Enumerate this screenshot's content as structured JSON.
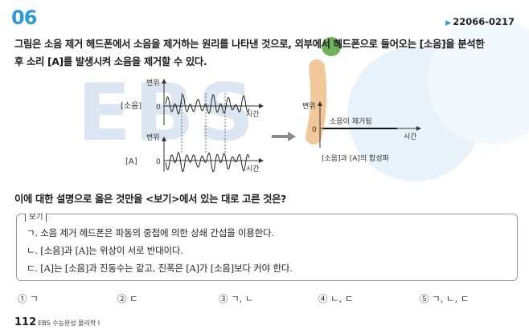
{
  "header": {
    "question_number": "06",
    "question_code": "22066-0217"
  },
  "stem": {
    "line1": "그림은 소음 제거 헤드폰에서 소음을 제거하는 원리를 나타낸 것으로, 외부에서 헤드폰으로 들어오는 [소음]을 분석한",
    "line2": "후 소리 [A]를 발생시켜 소음을 제거할 수 있다."
  },
  "figure": {
    "noise_label": "[소음]",
    "a_label": "[A]",
    "y_axis": "변위",
    "x_axis": "시간",
    "origin": "0",
    "result_annotation": "소음이 제거됨",
    "caption": "[소음]과 [A]의 합성파"
  },
  "question": "이에 대한 설명으로 옳은 것만을 <보기>에서 있는 대로 고른 것은?",
  "bogi": {
    "label": "보기",
    "items": [
      "ㄱ. 소음 제거 헤드폰은 파동의 중첩에 의한 상쇄 간섭을 이용한다.",
      "ㄴ. [소음]과 [A]는 위상이 서로 반대이다.",
      "ㄷ. [A]는 [소음]과 진동수는 같고, 진폭은 [A]가 [소음]보다 커야 한다."
    ]
  },
  "choices": [
    "① ㄱ",
    "② ㄷ",
    "③ ㄱ, ㄴ",
    "④ ㄴ, ㄷ",
    "⑤ ㄱ, ㄴ, ㄷ"
  ],
  "footer": {
    "page_number": "112",
    "book_title": "EBS 수능완성 물리학 Ⅰ"
  },
  "watermark": {
    "text": "EBS",
    "letter": "i",
    "colors": {
      "text": "#dbe6f2",
      "i_stroke": "#f2c79a",
      "i_dot": "#6fb15a",
      "circle": "#e8f2fa"
    }
  },
  "colors": {
    "accent": "#2a9bd7",
    "arrow": "#8a8a8a"
  }
}
